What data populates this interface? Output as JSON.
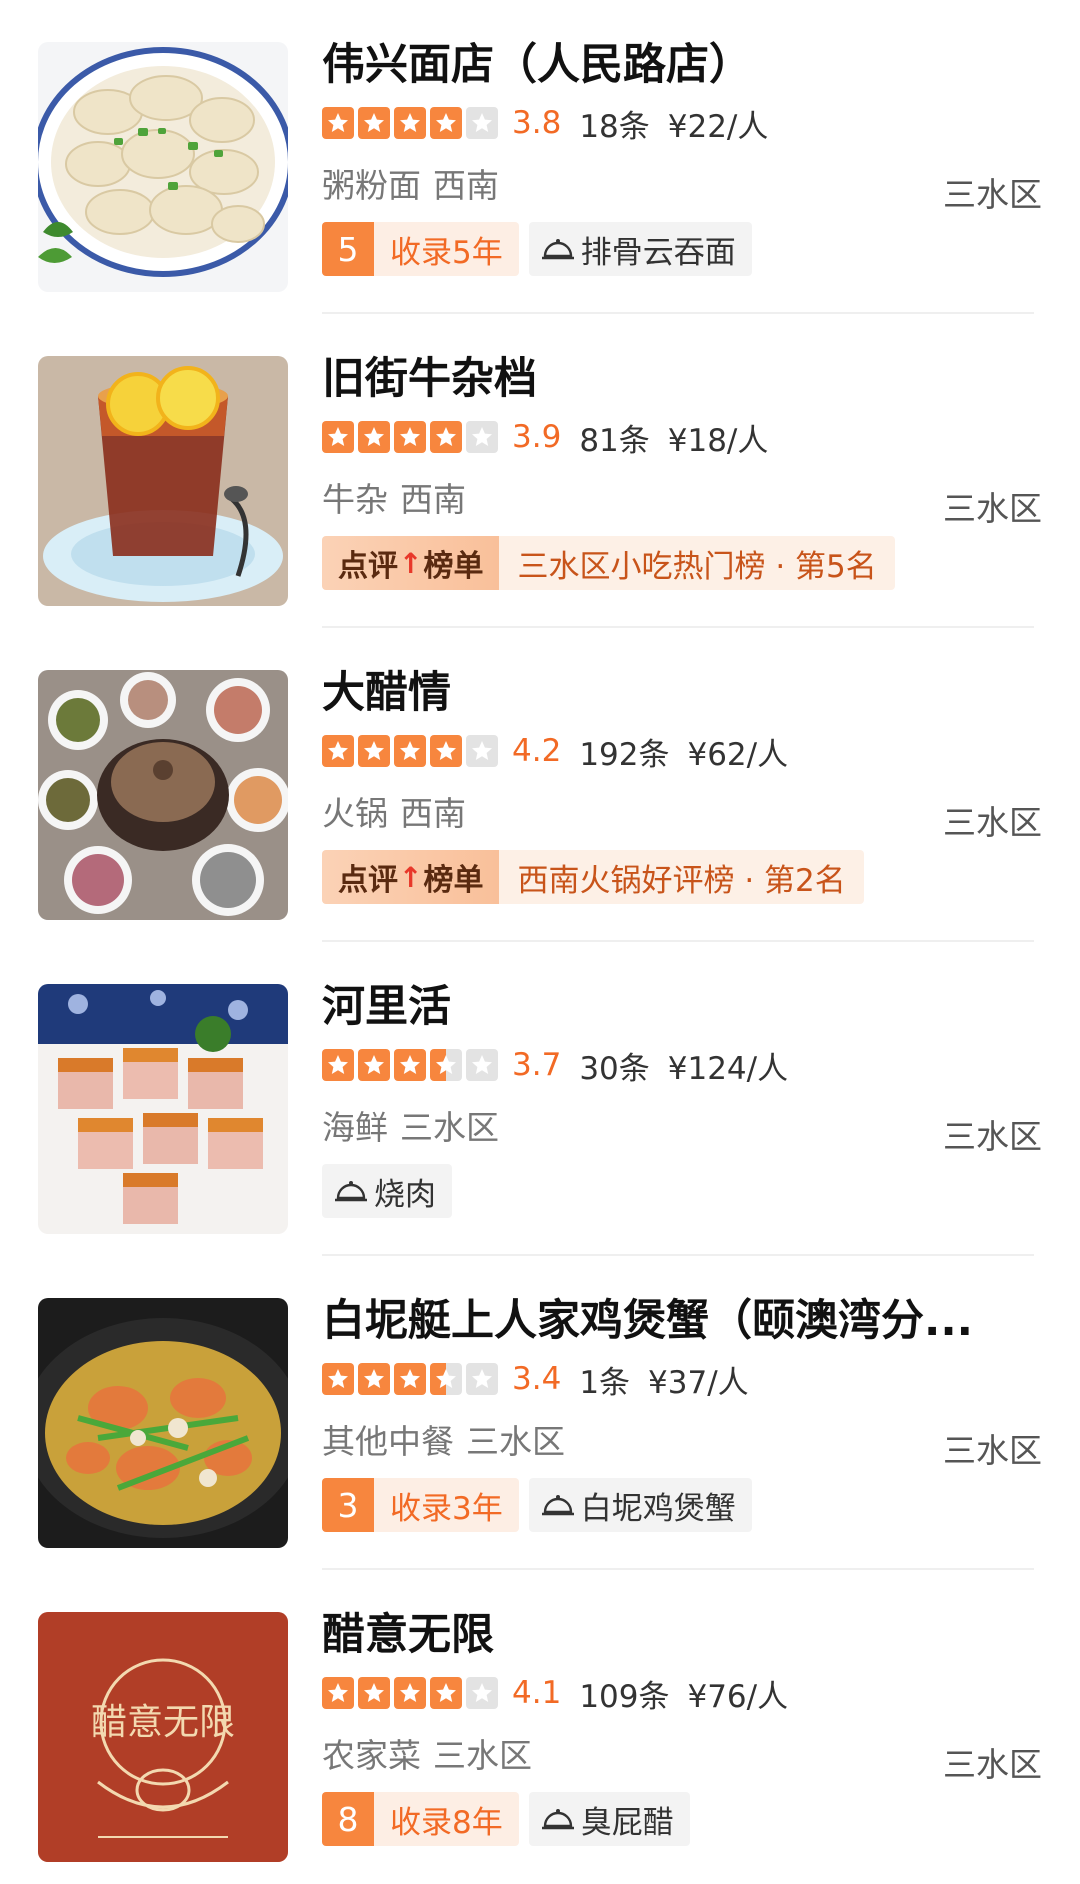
{
  "restaurants": [
    {
      "name": "伟兴面店（人民路店）",
      "rating": 3.8,
      "score": "3.8",
      "reviews": "18条",
      "price": "¥22/人",
      "category": "粥粉面",
      "region": "西南",
      "district": "三水区",
      "years_num": "5",
      "years_text": "收录5年",
      "dish": "排骨云吞面",
      "thumb_icon": "dumplings-image"
    },
    {
      "name": "旧街牛杂档",
      "rating": 3.9,
      "score": "3.9",
      "reviews": "81条",
      "price": "¥18/人",
      "category": "牛杂",
      "region": "西南",
      "district": "三水区",
      "rank_badge_a": "点评",
      "rank_badge_arrow": "↑",
      "rank_badge_b": "榜单",
      "rank_text": "三水区小吃热门榜 · 第5名",
      "thumb_icon": "lemon-tea-image"
    },
    {
      "name": "大醋情",
      "rating": 4.2,
      "score": "4.2",
      "reviews": "192条",
      "price": "¥62/人",
      "category": "火锅",
      "region": "西南",
      "district": "三水区",
      "rank_badge_a": "点评",
      "rank_badge_arrow": "↑",
      "rank_badge_b": "榜单",
      "rank_text": "西南火锅好评榜 · 第2名",
      "thumb_icon": "hotpot-image"
    },
    {
      "name": "河里活",
      "rating": 3.7,
      "score": "3.7",
      "reviews": "30条",
      "price": "¥124/人",
      "category": "海鲜",
      "region": "三水区",
      "district": "三水区",
      "dish": "烧肉",
      "thumb_icon": "roast-pork-image"
    },
    {
      "name": "白坭艇上人家鸡煲蟹（颐澳湾分...",
      "rating": 3.4,
      "score": "3.4",
      "reviews": "1条",
      "price": "¥37/人",
      "category": "其他中餐",
      "region": "三水区",
      "district": "三水区",
      "years_num": "3",
      "years_text": "收录3年",
      "dish": "白坭鸡煲蟹",
      "thumb_icon": "crab-pot-image"
    },
    {
      "name": "醋意无限",
      "rating": 4.1,
      "score": "4.1",
      "reviews": "109条",
      "price": "¥76/人",
      "category": "农家菜",
      "region": "三水区",
      "district": "三水区",
      "years_num": "8",
      "years_text": "收录8年",
      "dish": "臭屁醋",
      "thumb_icon": "logo-image",
      "logo_text": "醋意无限"
    }
  ],
  "colors": {
    "accent": "#f26a25",
    "star_on": "#f7863e",
    "star_off": "#e3e3e3"
  }
}
